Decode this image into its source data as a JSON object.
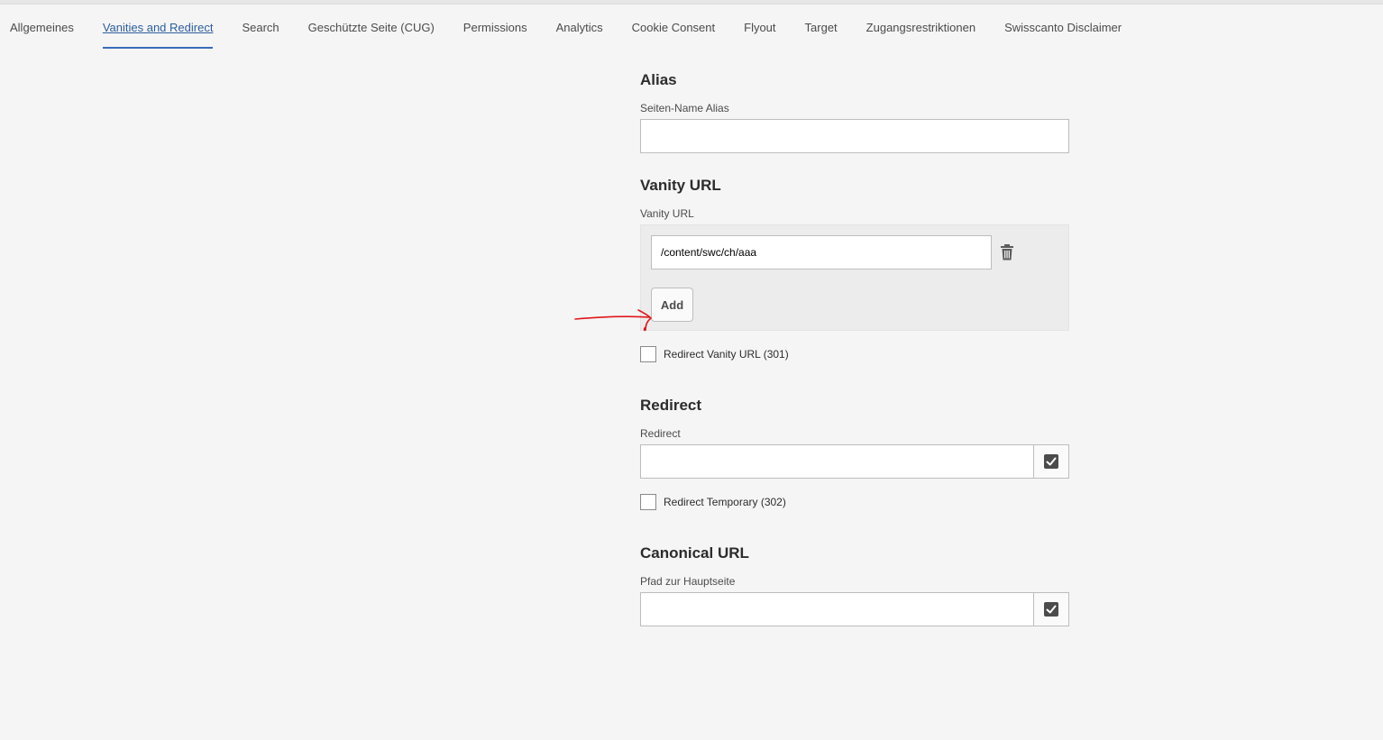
{
  "tabs": [
    {
      "label": "Allgemeines"
    },
    {
      "label": "Vanities and Redirect"
    },
    {
      "label": "Search"
    },
    {
      "label": "Geschützte Seite (CUG)"
    },
    {
      "label": "Permissions"
    },
    {
      "label": "Analytics"
    },
    {
      "label": "Cookie Consent"
    },
    {
      "label": "Flyout"
    },
    {
      "label": "Target"
    },
    {
      "label": "Zugangsrestriktionen"
    },
    {
      "label": "Swisscanto Disclaimer"
    }
  ],
  "alias": {
    "title": "Alias",
    "label": "Seiten-Name Alias",
    "value": ""
  },
  "vanity": {
    "title": "Vanity URL",
    "label": "Vanity URL",
    "items": [
      {
        "value": "/content/swc/ch/aaa"
      }
    ],
    "add_label": "Add",
    "redirect_checkbox_label": "Redirect Vanity URL (301)"
  },
  "redirect": {
    "title": "Redirect",
    "label": "Redirect",
    "value": "",
    "temporary_checkbox_label": "Redirect Temporary (302)"
  },
  "canonical": {
    "title": "Canonical URL",
    "label": "Pfad zur Hauptseite",
    "value": ""
  },
  "colors": {
    "active_tab": "#2c5e9e",
    "annotation": "#e0161b"
  }
}
